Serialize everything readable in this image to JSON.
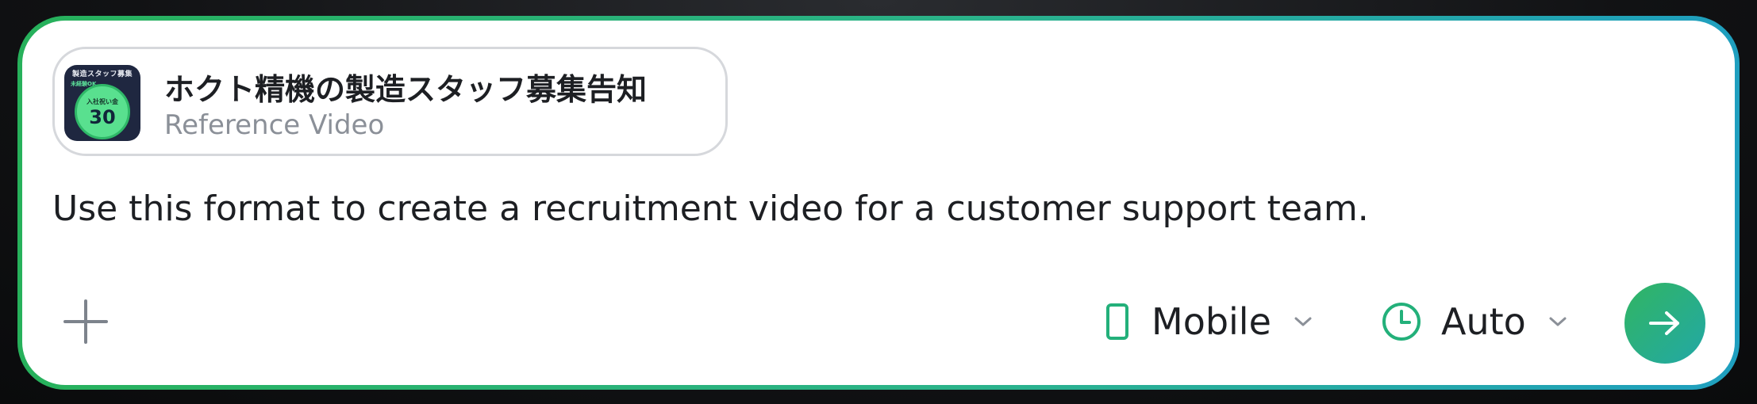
{
  "reference": {
    "title": "ホクト精機の製造スタッフ募集告知",
    "subtitle": "Reference Video",
    "thumbnail": {
      "top_text": "製造スタッフ募集",
      "side_text": "未経験OK",
      "small_text": "入社祝い金",
      "number": "30"
    }
  },
  "prompt": {
    "text": "Use this format to create a recruitment video for a customer support team."
  },
  "toolbar": {
    "add_icon": "plus-icon",
    "aspect": {
      "icon": "phone-icon",
      "label": "Mobile"
    },
    "duration": {
      "icon": "clock-icon",
      "label": "Auto"
    },
    "send_icon": "arrow-right-icon"
  },
  "colors": {
    "accent_green": "#27b15b",
    "accent_teal": "#1f9fbf",
    "icon_green": "#23b07a"
  }
}
